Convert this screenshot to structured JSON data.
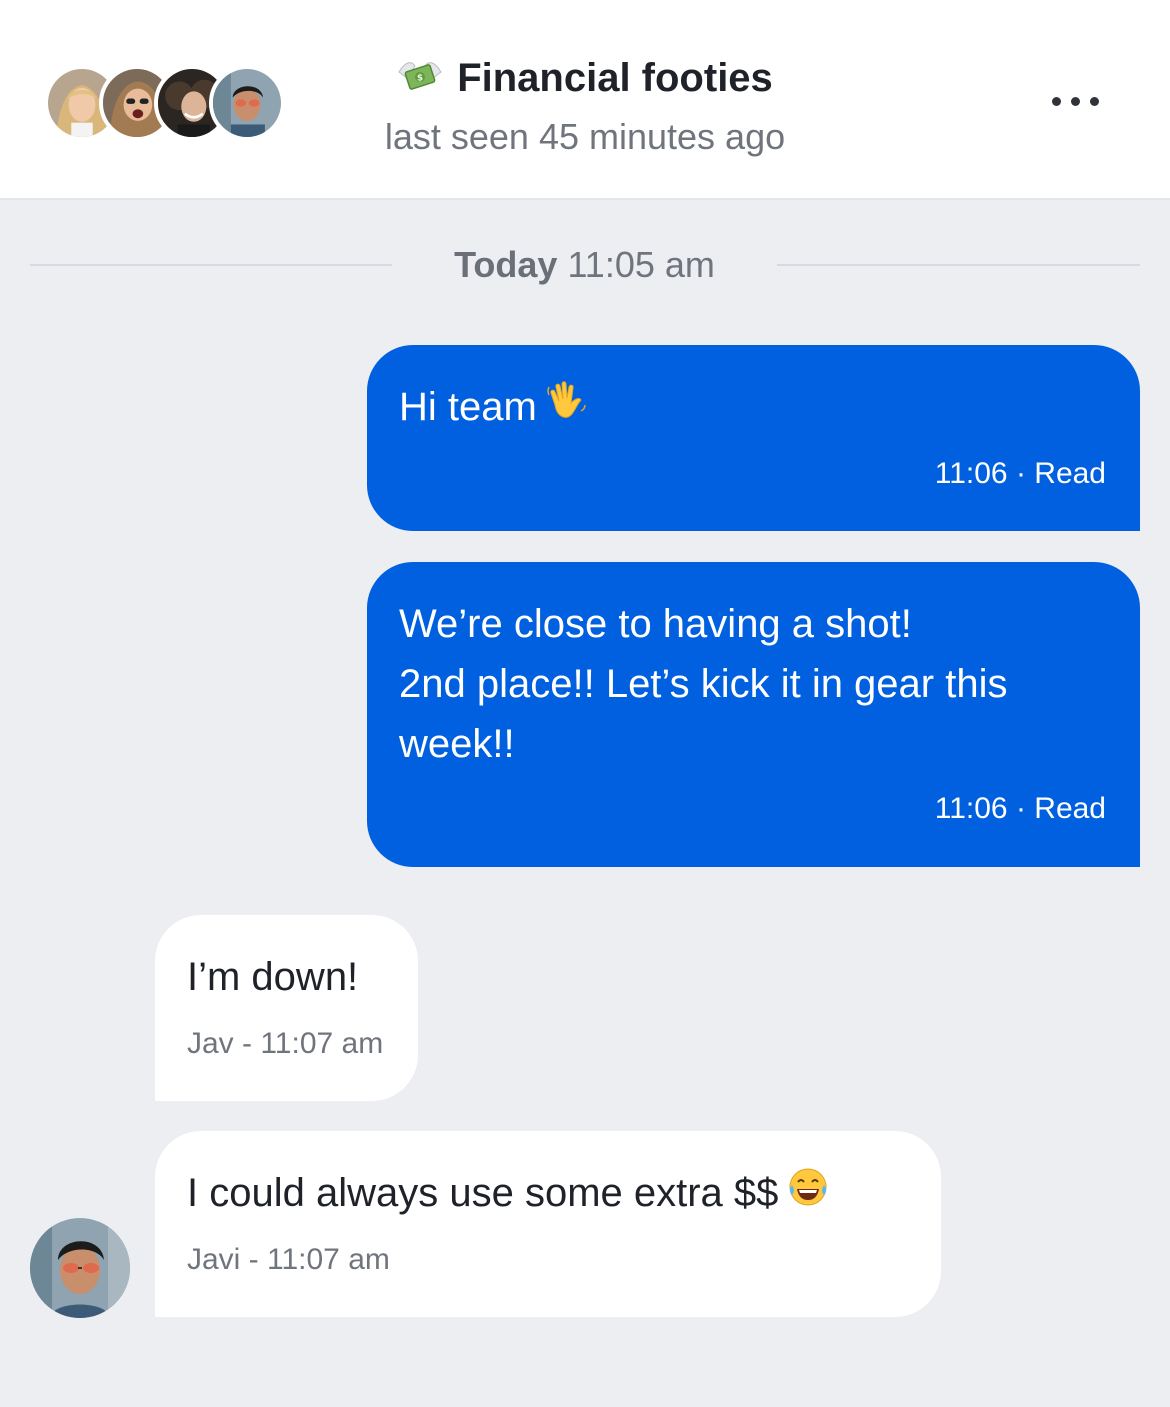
{
  "header": {
    "title_emoji": "money-with-wings-icon",
    "title": "Financial footies",
    "subtitle": "last seen 45 minutes ago",
    "more_icon": "more-horizontal-icon",
    "avatars": [
      "avatar-blonde-woman",
      "avatar-laughing-woman",
      "avatar-curly-hair-woman",
      "avatar-man-sunglasses"
    ]
  },
  "divider": {
    "day": "Today",
    "time": "11:05 am"
  },
  "messages": [
    {
      "direction": "outgoing",
      "lines": [
        "Hi team"
      ],
      "emoji": "waving-hand-icon",
      "meta": "11:06 · Read"
    },
    {
      "direction": "outgoing",
      "lines": [
        "We’re close to having a shot!",
        "2nd place!! Let’s kick it in gear this",
        "week!!"
      ],
      "meta": "11:06 · Read"
    },
    {
      "direction": "incoming",
      "lines": [
        "I’m down!"
      ],
      "meta": "Jav - 11:07 am"
    },
    {
      "direction": "incoming",
      "lines": [
        "I could always use some extra $$"
      ],
      "emoji": "tears-of-joy-icon",
      "meta": "Javi - 11:07 am"
    }
  ],
  "colors": {
    "outgoing_bubble": "#0060DF",
    "incoming_bubble": "#FFFFFF",
    "background": "#ECEEF2"
  }
}
